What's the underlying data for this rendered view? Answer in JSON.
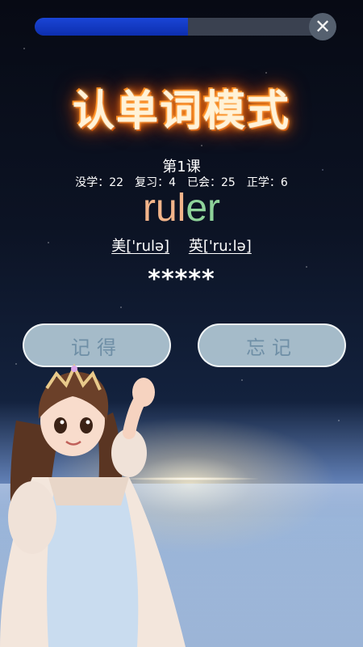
{
  "progress": {
    "value_percent": 51
  },
  "close": {
    "icon": "close-icon",
    "glyph": "✕"
  },
  "title": "认单词模式",
  "lesson": "第1课",
  "stats": {
    "unlearned": "没学：22",
    "review": "复习：4",
    "mastered": "已会：25",
    "learning": "正学：6"
  },
  "word": {
    "part1": "rul",
    "part2": "er"
  },
  "phonetics": {
    "us": "美['rulə]",
    "uk": "英['ruːlə]"
  },
  "masked": "*****",
  "buttons": {
    "remember": "记得",
    "forget": "忘记"
  },
  "colors": {
    "progress_fill": "#1a45d6",
    "button_bg": "#bad2de",
    "button_text": "#6f8fa6",
    "word_part1": "#f2b48a",
    "word_part2": "#8fd39a",
    "title_glow": "#ff6a00"
  }
}
